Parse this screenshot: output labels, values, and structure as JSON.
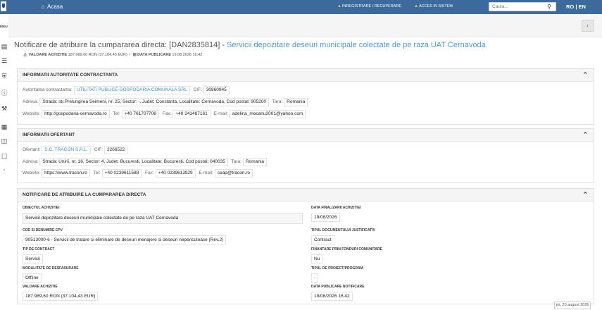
{
  "topbar": {
    "home": "Acasa",
    "register": "INREGISTRARE / RECUPERARE",
    "access": "ACCES IN SISTEM",
    "search_placeholder": "Cauta...",
    "lang": "RO | EN"
  },
  "sidebar": {
    "menu_label": "ENIU",
    "icons": [
      "document-icon",
      "list-icon",
      "shield-icon",
      "help-icon",
      "tools-icon",
      "id-card-icon",
      "table-icon",
      "comment-icon",
      "chevron-right-icon"
    ]
  },
  "header": {
    "title_prefix": "Notificare de atribuire la cumpararea directa: [DAN2835814] -",
    "title_link": "Servicii depozitare deseuri municipale colectate de pe raza UAT Cernavoda",
    "value_label": "VALOARE ACHIZITIE",
    "value": "187.989,60 RON (37.104,43 EUR)",
    "date_label": "DATA PUBLICARE",
    "date": "19.08.2026 16:42"
  },
  "authority": {
    "heading": "INFORMATII AUTORITATE CONTRACTANTA",
    "name_label": "Autoritatea contractanta:",
    "name": "UTILITATI PUBLICE-GOSPODARIA COMUNALA SRL",
    "cif_label": "CIF:",
    "cif": "30860945",
    "address_label": "Adresa:",
    "address": "Strada: str.Prelungirea Seimeni, nr. 25, Sector: -, Judet: Constanta, Localitate: Cernavoda, Cod postal: 905200",
    "country_label": "Tara:",
    "country": "Romania",
    "website_label": "Website:",
    "website": "http://gospodaria-cernavoda.ro",
    "tel_label": "Tel:",
    "tel": "+40 761707708",
    "fax_label": "Fax:",
    "fax": "+40 241487161",
    "email_label": "E-mail:",
    "email": "adelina_mocanu2001@yahoo.com"
  },
  "bidder": {
    "heading": "INFORMATII OFERTANT",
    "name_label": "Ofertant:",
    "name": "S.C. TRACON S.R.L.",
    "cif_label": "CIF:",
    "cif": "2266522",
    "address_label": "Adresa:",
    "address": "Strada: Unirii, nr. 16, Sector: 4, Judet: Bucuresti, Localitate: Bucuresti, Cod postal: 040035",
    "country_label": "Tara:",
    "country": "Romania",
    "website_label": "Website:",
    "website": "https://www.tracon.ro",
    "tel_label": "Tel:",
    "tel": "+40 0239611588",
    "fax_label": "Fax:",
    "fax": "+40 0239613929",
    "email_label": "E-mail:",
    "email": "seap@tracon.ro"
  },
  "notice": {
    "heading": "NOTIFICARE DE ATRIBUIRE LA CUMPARAREA DIRECTA",
    "object_label": "OBIECTUL ACHIZITIEI",
    "object": "Servicii depozitare deseuri municipale colectate de pe raza UAT Cernavoda",
    "end_date_label": "DATA FINALIZARII ACHIZITIEI",
    "end_date": "19/08/2026",
    "cpv_label": "COD SI DENUMIRE CPV",
    "cpv": "90513000-6 - Servicii de tratare si eliminare de deseuri menajere si deseuri nepericuloase (Rev.2)",
    "doc_type_label": "TIPUL DOCUMENTULUI JUSTIFICATIV",
    "doc_type": "Contract",
    "contract_type_label": "TIP DE CONTRACT",
    "contract_type": "Servicii",
    "eu_funds_label": "FINANTARE PRIN FONDURI COMUNITARE",
    "eu_funds": "Nu",
    "mode_label": "MODALITATE DE DESFASURARE",
    "mode": "Offline",
    "project_type_label": "TIPUL DE PROIECT/PROGRAM",
    "project_type": "-",
    "value_label": "VALOARE ACHIZITIE",
    "value": "187.989,60 RON (37.104,43 EUR)",
    "pub_date_label": "DATA PUBLICARE NOTIFICARE",
    "pub_date": "19/08/2026 16:42"
  },
  "footer": {
    "date": "joi, 20 august 2026"
  }
}
